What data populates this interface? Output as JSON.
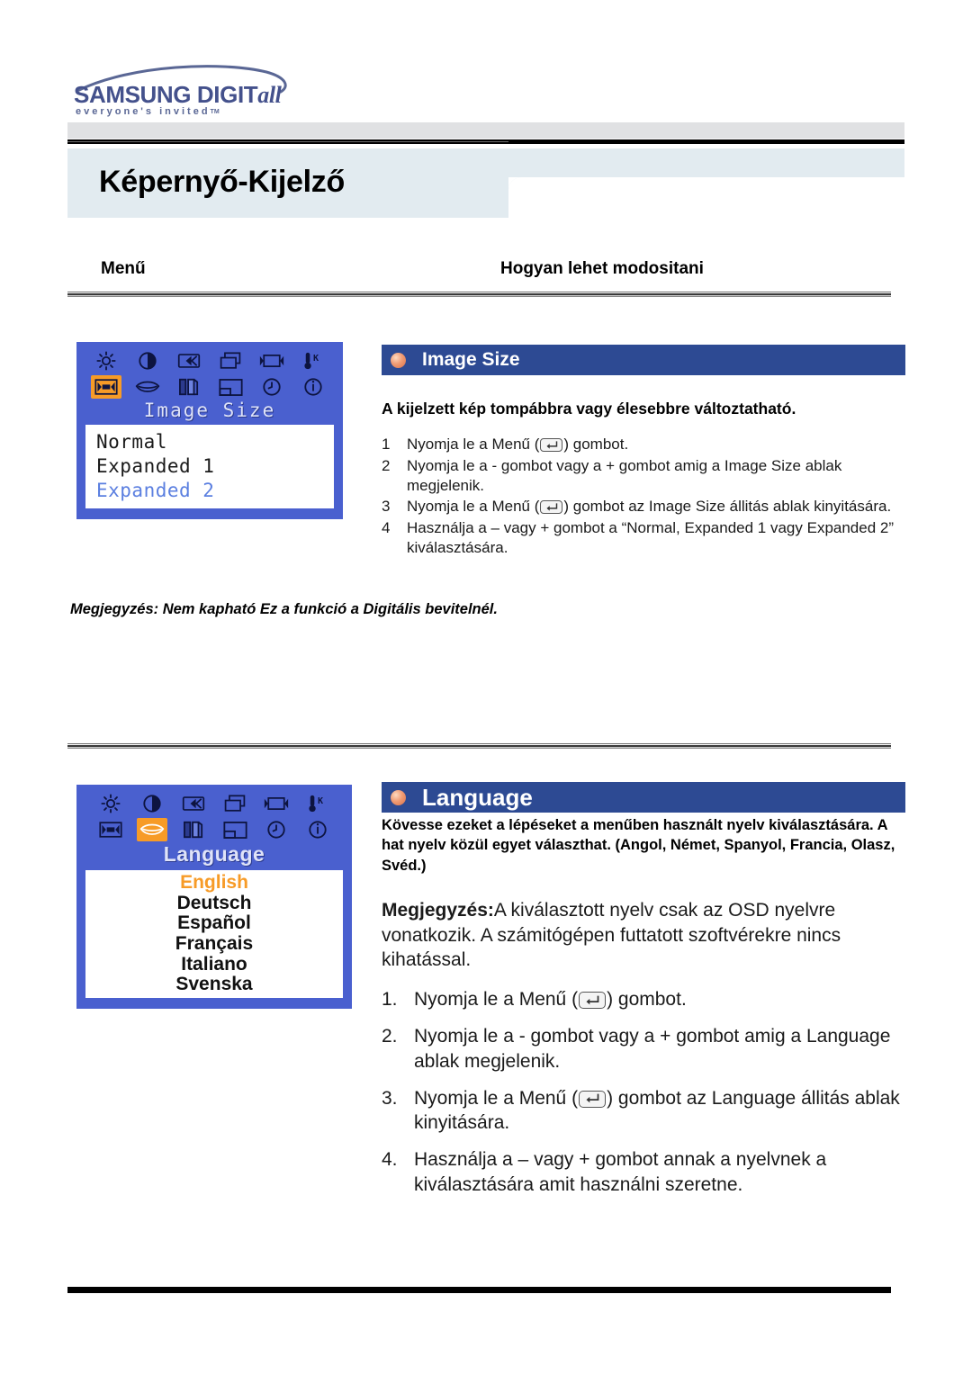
{
  "logo": {
    "brand": "SAMSUNG DIGIT",
    "brand_italic": "all",
    "tagline": "everyone's invited",
    "tm": "TM"
  },
  "header": {
    "page_title": "Képernyő-Kijelző",
    "col_menu": "Menű",
    "col_how": "Hogyan lehet modositani"
  },
  "sections": [
    {
      "id": "image-size",
      "heading": "Image Size",
      "osd": {
        "title": "Image Size",
        "icons_row1": [
          "brightness-icon",
          "contrast-icon",
          "h-position-icon",
          "v-position-icon",
          "image-lock-icon",
          "color-temp-icon"
        ],
        "icons_row2": [
          "image-size-icon",
          "language-icon",
          "coarse-fine-icon",
          "osd-position-icon",
          "osd-time-icon",
          "information-icon"
        ],
        "selected_icon": "image-size-icon",
        "items": [
          {
            "label": "Normal",
            "state": "normal"
          },
          {
            "label": "Expanded 1",
            "state": "normal"
          },
          {
            "label": "Expanded 2",
            "state": "dim"
          }
        ]
      },
      "intro": "A kijelzett kép tompábbra vagy élesebbre változtatható.",
      "steps": [
        {
          "num": "1",
          "text_pre": "Nyomja le a Menű  (",
          "key": "enter-key-icon",
          "text_post": ") gombot."
        },
        {
          "num": "2",
          "text_pre": "Nyomja le a - gombot vagy a + gombot amig a Image Size ablak megjelenik.",
          "key": "",
          "text_post": ""
        },
        {
          "num": "3",
          "text_pre": "Nyomja le a Menű  (",
          "key": "enter-key-icon",
          "text_post": ") gombot az Image Size állitás ablak kinyitására."
        },
        {
          "num": "4",
          "text_pre": "Használja a – vagy + gombot a “Normal, Expanded 1 vagy Expanded 2” kiválasztására.",
          "key": "",
          "text_post": ""
        }
      ],
      "note": "Megjegyzés: Nem kapható Ez a funkció a Digitális bevitelnél."
    },
    {
      "id": "language",
      "heading": "Language",
      "osd": {
        "title": "Language",
        "selected_icon": "language-icon",
        "items": [
          {
            "label": "English",
            "state": "hl"
          },
          {
            "label": "Deutsch",
            "state": "normal"
          },
          {
            "label": "Español",
            "state": "normal"
          },
          {
            "label": "Français",
            "state": "normal"
          },
          {
            "label": "Italiano",
            "state": "normal"
          },
          {
            "label": "Svenska",
            "state": "normal"
          }
        ]
      },
      "intro": "Kövesse ezeket a lépéseket a menűben használt nyelv kiválasztására. A hat nyelv közül egyet választhat. (Angol, Német, Spanyol, Francia, Olasz, Svéd.)",
      "note_label": "Megjegyzés:",
      "note_body": "A kiválasztott nyelv csak az OSD nyelvre vonatkozik. A számitógépen futtatott szoftvérekre nincs kihatással.",
      "steps": [
        {
          "num": "1.",
          "text_pre": "Nyomja le a Menű  (",
          "key": "enter-key-icon",
          "text_post": ") gombot."
        },
        {
          "num": "2.",
          "text_pre": "Nyomja le a - gombot vagy a + gombot amig a Language ablak megjelenik.",
          "key": "",
          "text_post": ""
        },
        {
          "num": "3.",
          "text_pre": "Nyomja le a Menű (",
          "key": "enter-key-icon",
          "text_post": ") gombot az Language állitás ablak kinyitására."
        },
        {
          "num": "4.",
          "text_pre": "Használja a – vagy + gombot annak a nyelvnek a kiválasztására amit használni szeretne.",
          "key": "",
          "text_post": ""
        }
      ]
    }
  ],
  "colors": {
    "osd_blue": "#4a60cf",
    "osd_highlight": "#f79b27",
    "section_header_blue": "#2d4a93",
    "title_band": "#e2ebf0",
    "logo_blue": "#44518c"
  }
}
